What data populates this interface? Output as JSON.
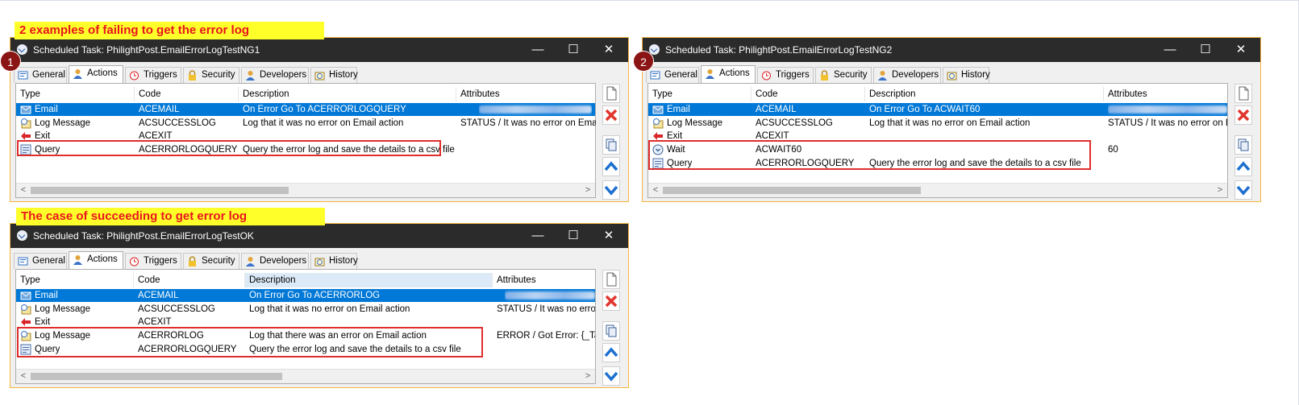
{
  "banners": {
    "failing": "2 examples of failing to get the error log",
    "succeeding": "The case of succeeding to get error log"
  },
  "badges": {
    "one": "1",
    "two": "2"
  },
  "tabs": [
    "General",
    "Actions",
    "Triggers",
    "Security",
    "Developers",
    "History"
  ],
  "columns": {
    "type": "Type",
    "code": "Code",
    "description": "Description",
    "attributes": "Attributes"
  },
  "window_controls": {
    "minimize": "—",
    "maximize": "☐",
    "close": "✕"
  },
  "windows": [
    {
      "title": "Scheduled Task: PhilightPost.EmailErrorLogTestNG1",
      "rows": [
        {
          "type": "Email",
          "code": "ACEMAIL",
          "description": "On Error Go To ACERRORLOGQUERY",
          "attributes": "",
          "icon": "email-icon",
          "selected": true
        },
        {
          "type": "Log Message",
          "code": "ACSUCCESSLOG",
          "description": "Log that it was no error on Email action",
          "attributes": "STATUS / It was no error on Email a",
          "icon": "log-message-icon"
        },
        {
          "type": "Exit",
          "code": "ACEXIT",
          "description": "",
          "attributes": "",
          "icon": "exit-arrow-icon"
        },
        {
          "type": "Query",
          "code": "ACERRORLOGQUERY",
          "description": "Query the error log and save the details to a csv file",
          "attributes": "",
          "icon": "query-icon"
        }
      ]
    },
    {
      "title": "Scheduled Task: PhilightPost.EmailErrorLogTestNG2",
      "rows": [
        {
          "type": "Email",
          "code": "ACEMAIL",
          "description": "On Error Go To ACWAIT60",
          "attributes": "",
          "icon": "email-icon",
          "selected": true
        },
        {
          "type": "Log Message",
          "code": "ACSUCCESSLOG",
          "description": "Log that it was no error on Email action",
          "attributes": "STATUS / It was no error on En",
          "icon": "log-message-icon"
        },
        {
          "type": "Exit",
          "code": "ACEXIT",
          "description": "",
          "attributes": "",
          "icon": "exit-arrow-icon"
        },
        {
          "type": "Wait",
          "code": "ACWAIT60",
          "description": "",
          "attributes": "60",
          "icon": "wait-icon"
        },
        {
          "type": "Query",
          "code": "ACERRORLOGQUERY",
          "description": "Query the error log and save the details to a csv file",
          "attributes": "",
          "icon": "query-icon"
        }
      ]
    },
    {
      "title": "Scheduled Task: PhilightPost.EmailErrorLogTestOK",
      "rows": [
        {
          "type": "Email",
          "code": "ACEMAIL",
          "description": "On Error Go To ACERRORLOG",
          "attributes": "",
          "icon": "email-icon",
          "selected": true
        },
        {
          "type": "Log Message",
          "code": "ACSUCCESSLOG",
          "description": "Log that it was no error on Email action",
          "attributes": "STATUS / It was no error",
          "icon": "log-message-icon"
        },
        {
          "type": "Exit",
          "code": "ACEXIT",
          "description": "",
          "attributes": "",
          "icon": "exit-arrow-icon"
        },
        {
          "type": "Log Message",
          "code": "ACERRORLOG",
          "description": "Log that there was an error on Email action",
          "attributes": "ERROR / Got Error: {_Ta",
          "icon": "log-message-icon"
        },
        {
          "type": "Query",
          "code": "ACERRORLOGQUERY",
          "description": "Query the error log and save the details to a csv file",
          "attributes": "",
          "icon": "query-icon"
        }
      ]
    }
  ],
  "colors": {
    "selection": "#0078d7",
    "highlight_box": "#e02d2d",
    "banner_bg": "#ffff2a",
    "banner_text": "#e8141c",
    "titlebar": "#2b2b2b",
    "badge": "#8b1414"
  }
}
